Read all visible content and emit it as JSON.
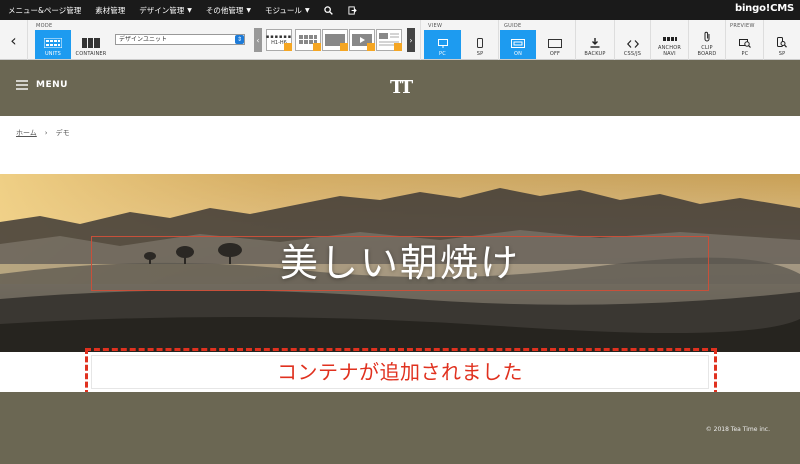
{
  "topbar": {
    "menu": [
      {
        "label": "メニュー&ページ管理",
        "dropdown": false
      },
      {
        "label": "素材管理",
        "dropdown": false
      },
      {
        "label": "デザイン管理",
        "dropdown": true
      },
      {
        "label": "その他管理",
        "dropdown": true
      },
      {
        "label": "モジュール",
        "dropdown": true
      }
    ],
    "brand": "bingo!CMS"
  },
  "toolbar": {
    "mode_label": "MODE",
    "units_label": "UNITS",
    "container_label": "CONTAINER",
    "unit_select_value": "デザインユニット",
    "thumb1_label": "H1-H6",
    "view_label": "VIEW",
    "pc_label": "PC",
    "sp_label": "SP",
    "guide_label": "GUIDE",
    "on_label": "ON",
    "off_label": "OFF",
    "backup_label": "BACKUP",
    "cssjs_label": "CSS/JS",
    "anchor_label": "ANCHOR NAVI",
    "clip_label": "CLIP BOARD",
    "preview_label": "PREVIEW",
    "preview_pc_label": "PC",
    "preview_sp_label": "SP"
  },
  "site": {
    "menu_label": "MENU",
    "logo": "TT",
    "breadcrumb": {
      "home": "ホーム",
      "separator": "›",
      "current": "デモ"
    },
    "hero_title": "美しい朝焼け",
    "container_message": "コンテナが追加されました",
    "copyright": "© 2018 Tea Time inc."
  },
  "colors": {
    "accent": "#1d9bf0",
    "header_bg": "#6b6753",
    "dash_red": "#e0311f"
  }
}
